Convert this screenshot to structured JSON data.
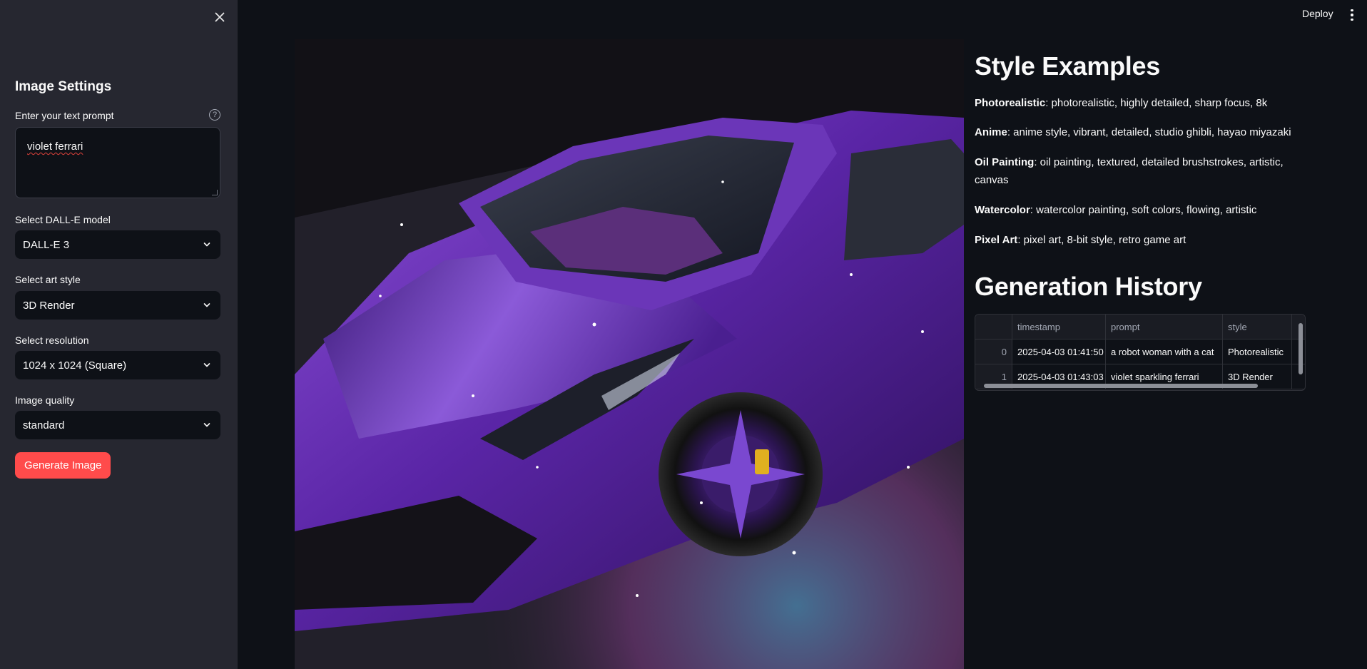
{
  "header": {
    "deploy_label": "Deploy",
    "menu_icon": "vertical-dots-icon"
  },
  "sidebar": {
    "close_icon": "close-icon",
    "title": "Image Settings",
    "prompt": {
      "label": "Enter your text prompt",
      "help_icon": "question-circle-icon",
      "value": "violet ferrari"
    },
    "model": {
      "label": "Select DALL-E model",
      "value": "DALL-E 3"
    },
    "art_style": {
      "label": "Select art style",
      "value": "3D Render"
    },
    "resolution": {
      "label": "Select resolution",
      "value": "1024 x 1024 (Square)"
    },
    "quality": {
      "label": "Image quality",
      "value": "standard"
    },
    "generate_label": "Generate Image"
  },
  "style_examples": {
    "title": "Style Examples",
    "items": [
      {
        "name": "Photorealistic",
        "desc": ": photorealistic, highly detailed, sharp focus, 8k"
      },
      {
        "name": "Anime",
        "desc": ": anime style, vibrant, detailed, studio ghibli, hayao miyazaki"
      },
      {
        "name": "Oil Painting",
        "desc": ": oil painting, textured, detailed brushstrokes, artistic, canvas"
      },
      {
        "name": "Watercolor",
        "desc": ": watercolor painting, soft colors, flowing, artistic"
      },
      {
        "name": "Pixel Art",
        "desc": ": pixel art, 8-bit style, retro game art"
      }
    ]
  },
  "history": {
    "title": "Generation History",
    "columns": [
      "",
      "timestamp",
      "prompt",
      "style"
    ],
    "rows": [
      {
        "index": "0",
        "timestamp": "2025-04-03 01:41:50",
        "prompt": "a robot woman with a cat",
        "style": "Photorealistic"
      },
      {
        "index": "1",
        "timestamp": "2025-04-03 01:43:03",
        "prompt": "violet sparkling ferrari",
        "style": "3D Render"
      }
    ]
  },
  "colors": {
    "background": "#0e1117",
    "sidebar": "#262730",
    "primary": "#ff4b4b",
    "text": "#fafafa"
  }
}
